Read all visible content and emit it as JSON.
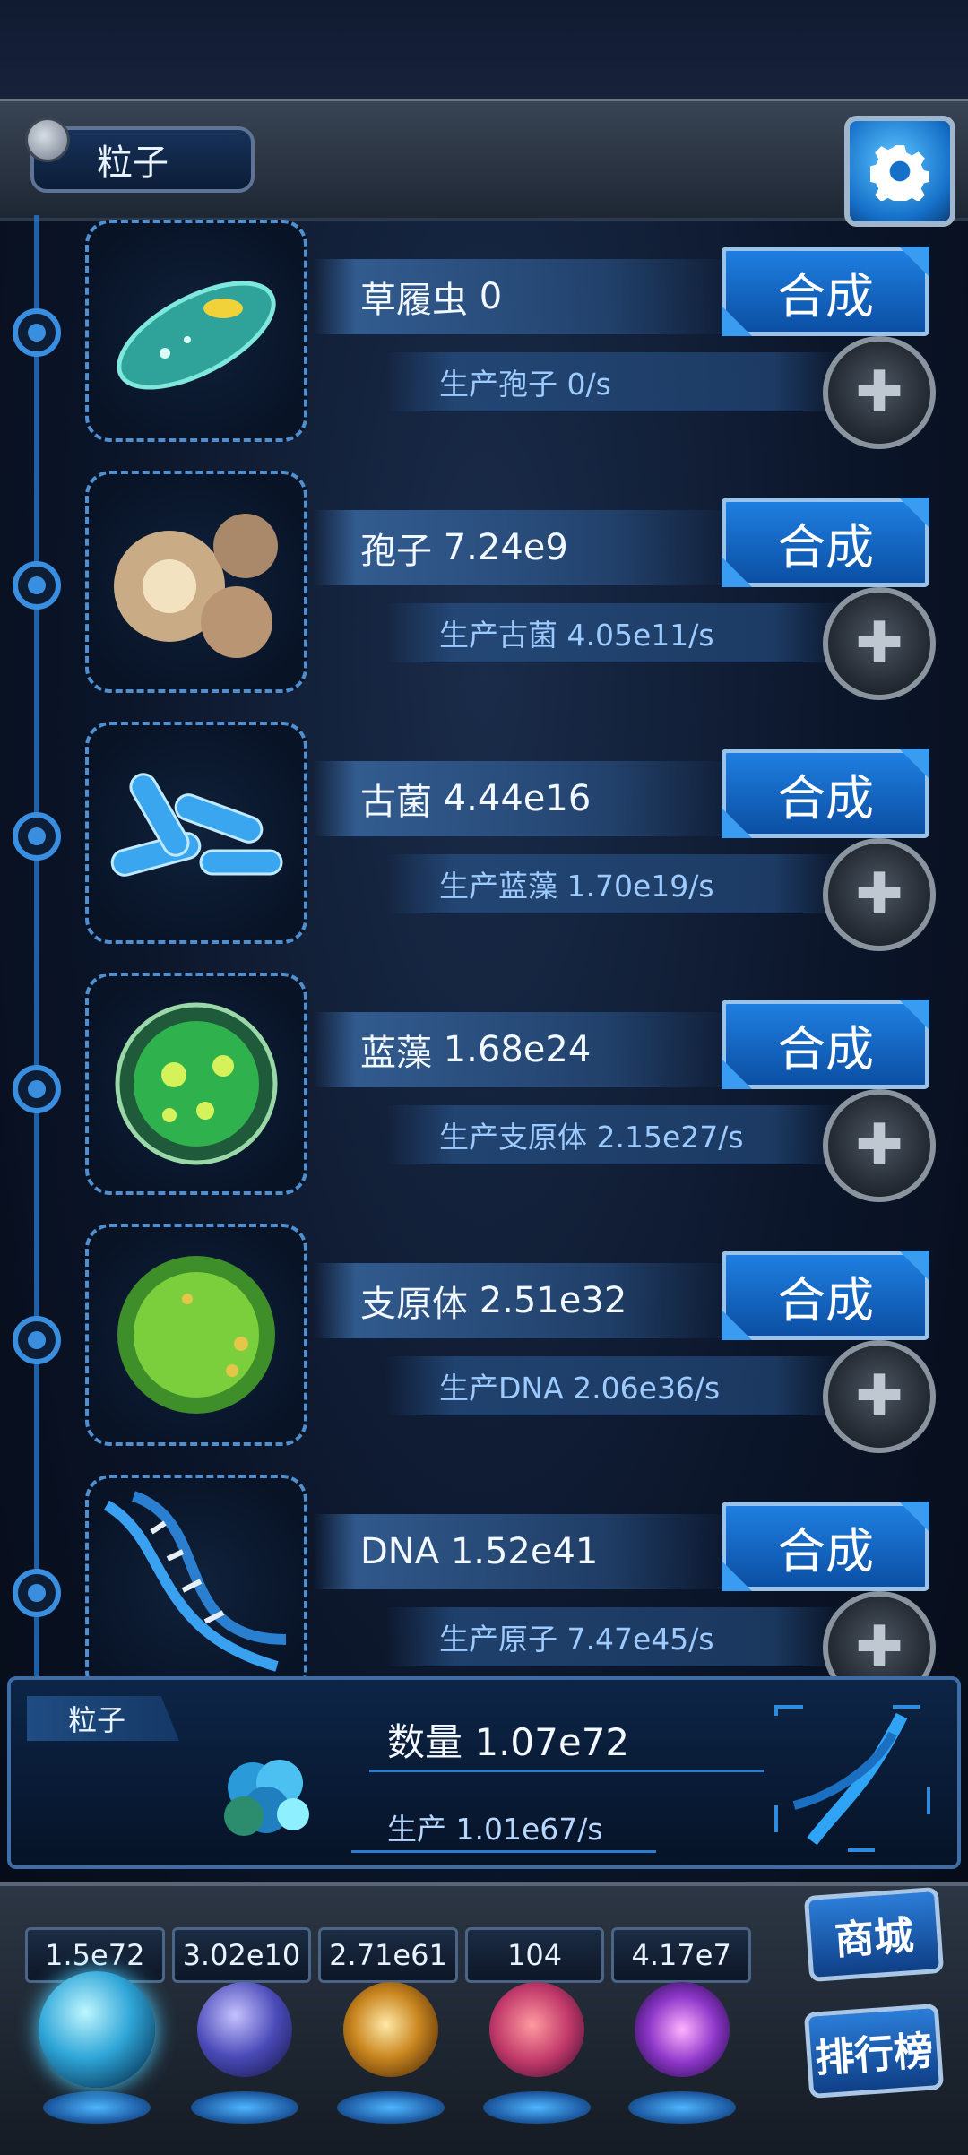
{
  "header": {
    "title": "粒子"
  },
  "creatures": [
    {
      "name": "草履虫",
      "count": "0",
      "synth_label": "合成",
      "production": "生产孢子 0/s"
    },
    {
      "name": "孢子",
      "count": "7.24e9",
      "synth_label": "合成",
      "production": "生产古菌 4.05e11/s"
    },
    {
      "name": "古菌",
      "count": "4.44e16",
      "synth_label": "合成",
      "production": "生产蓝藻 1.70e19/s"
    },
    {
      "name": "蓝藻",
      "count": "1.68e24",
      "synth_label": "合成",
      "production": "生产支原体 2.15e27/s"
    },
    {
      "name": "支原体",
      "count": "2.51e32",
      "synth_label": "合成",
      "production": "生产DNA 2.06e36/s"
    },
    {
      "name": "DNA",
      "count": "1.52e41",
      "synth_label": "合成",
      "production": "生产原子 7.47e45/s"
    }
  ],
  "particle_panel": {
    "tab": "粒子",
    "count_text": "数量 1.07e72",
    "rate_text": "生产 1.01e67/s"
  },
  "currencies": [
    {
      "value": "1.5e72",
      "icon": "particle-orb-icon"
    },
    {
      "value": "3.02e10",
      "icon": "lightning-orb-icon"
    },
    {
      "value": "2.71e61",
      "icon": "nebula-orb-icon"
    },
    {
      "value": "104",
      "icon": "brain-orb-icon"
    },
    {
      "value": "4.17e7",
      "icon": "vortex-orb-icon"
    }
  ],
  "side_buttons": {
    "shop": "商城",
    "ranking": "排行榜"
  },
  "colors": {
    "accent": "#1f7fe0",
    "panel": "#0d2547",
    "text_blue": "#9ecbff"
  }
}
